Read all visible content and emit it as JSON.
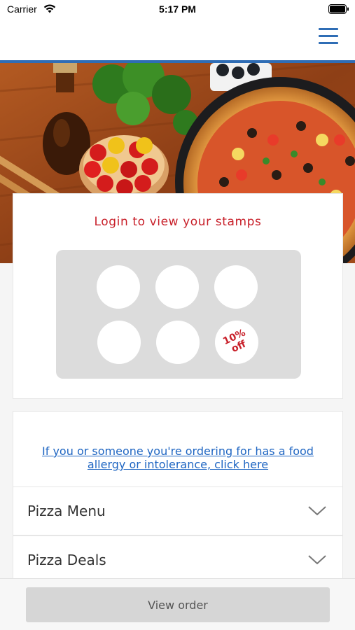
{
  "status_bar": {
    "carrier": "Carrier",
    "time": "5:17 PM"
  },
  "nav": {
    "menu_icon": "hamburger-menu-icon"
  },
  "hero": {
    "image": "pizza-ingredients-photo"
  },
  "stamp_card": {
    "title": "Login to view your stamps",
    "stamps_total": 6,
    "reward_line1": "10%",
    "reward_line2": "off"
  },
  "allergy": {
    "link_text": "If you or someone you're ordering for has a food allergy or intolerance, click here"
  },
  "menu_sections": [
    {
      "label": "Pizza Menu",
      "icon": "chevron-down-icon"
    },
    {
      "label": "Pizza Deals",
      "icon": "chevron-down-icon"
    }
  ],
  "bottom": {
    "view_order_label": "View order"
  },
  "colors": {
    "accent": "#2f6db5",
    "brand_red": "#c8202a",
    "link": "#1e65c2"
  }
}
